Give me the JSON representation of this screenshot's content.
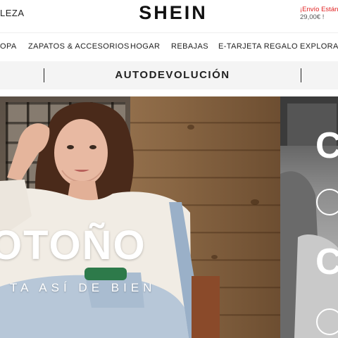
{
  "header": {
    "left_text": "LEZA",
    "logo": "SHEIN",
    "promo_line1": "¡Envío Estándar",
    "promo_line2": "29,00€ !"
  },
  "nav": {
    "items": [
      {
        "label": "OPA"
      },
      {
        "label": "ZAPATOS & ACCESORIOS"
      },
      {
        "label": "HOGAR"
      },
      {
        "label": "REBAJAS"
      },
      {
        "label": "E-TARJETA REGALO"
      },
      {
        "label": "EXPLORA"
      }
    ]
  },
  "banner": {
    "return_text": "AUTODEVOLUCIÓN"
  },
  "hero": {
    "title": "OTOÑO",
    "subtitle": "TA ASÍ DE BIEN",
    "side_letters": [
      "C",
      "C"
    ]
  },
  "colors": {
    "promo_red": "#e02020",
    "text_dark": "#222222",
    "banner_bg": "#f4f4f4",
    "wood_brown": "#8a6744"
  }
}
